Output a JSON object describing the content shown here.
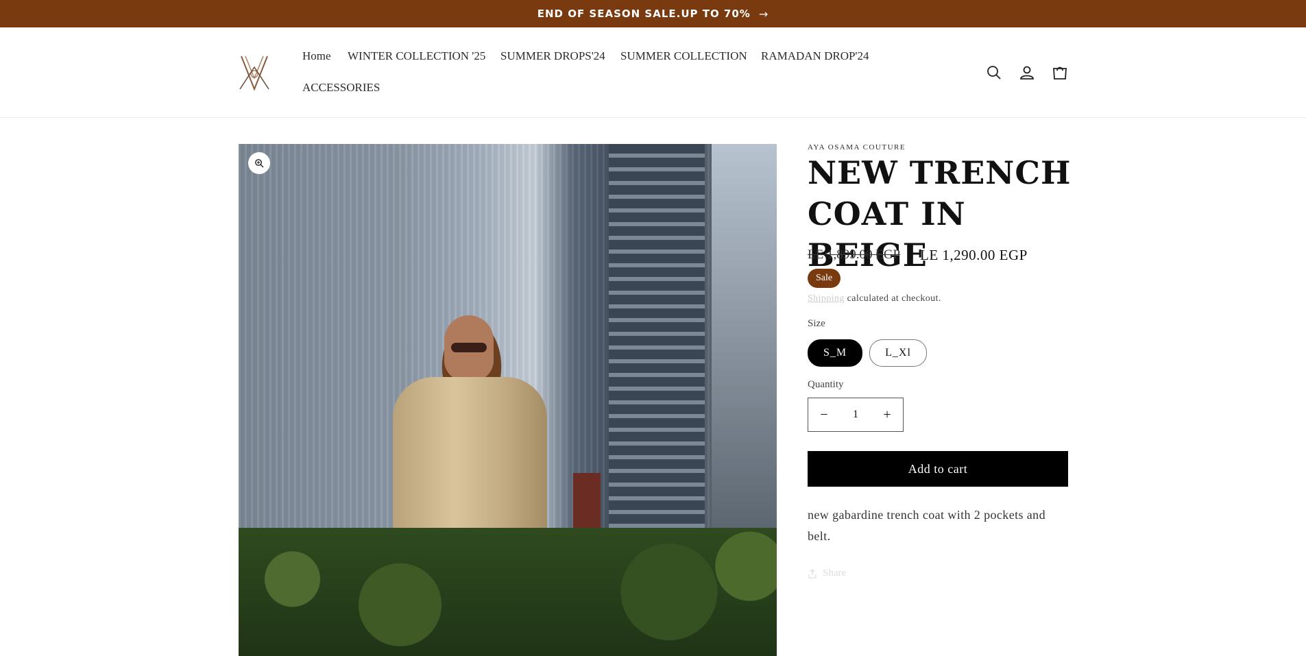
{
  "announcement": {
    "text": "END OF SEASON SALE.UP TO 70%",
    "arrow": "→"
  },
  "nav": {
    "items": [
      "Home",
      "WINTER COLLECTION '25",
      "SUMMER DROPS'24",
      "SUMMER COLLECTION",
      "RAMADAN DROP'24",
      "ACCESSORIES"
    ]
  },
  "header_icons": [
    "search-icon",
    "account-icon",
    "cart-icon"
  ],
  "product": {
    "vendor": "AYA OSAMA COUTURE",
    "title": "NEW TRENCH COAT IN BEIGE",
    "price_old": "LE 1,899.00 EGP",
    "price_new": "LE 1,290.00 EGP",
    "sale_badge": "Sale",
    "shipping_link": "Shipping",
    "shipping_text": "calculated at checkout.",
    "size_label": "Size",
    "sizes": [
      "S_M",
      "L_Xl"
    ],
    "selected_size": "S_M",
    "quantity_label": "Quantity",
    "quantity_minus": "−",
    "quantity_value": "1",
    "quantity_plus": "+",
    "add_to_cart": "Add to cart",
    "description": "new gabardine trench coat with 2 pockets and belt.",
    "share": "Share"
  },
  "colors": {
    "announcement_bg": "#7a3a10",
    "sale_badge_bg": "#7a3a10",
    "button_bg": "#000000"
  }
}
